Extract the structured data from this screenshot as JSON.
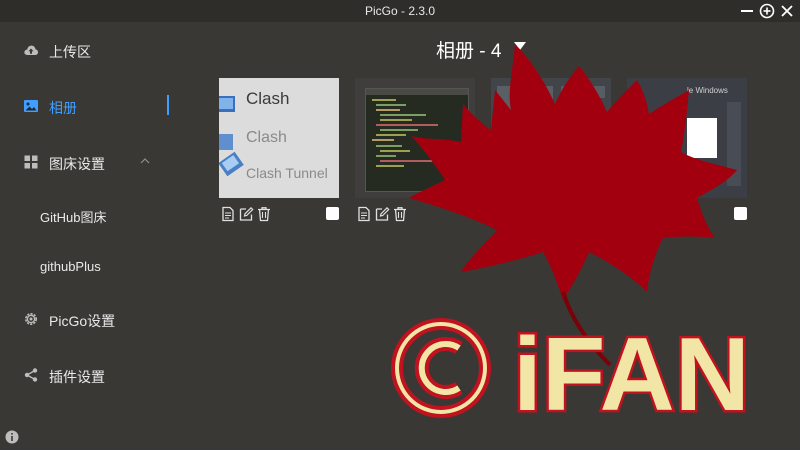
{
  "window": {
    "title": "PicGo - 2.3.0"
  },
  "sidebar": {
    "items": [
      {
        "label": "上传区",
        "icon": "cloud-upload-icon"
      },
      {
        "label": "相册",
        "icon": "image-icon"
      },
      {
        "label": "图床设置",
        "icon": "grid-icon"
      },
      {
        "label": "GitHub图床"
      },
      {
        "label": "githubPlus"
      },
      {
        "label": "PicGo设置",
        "icon": "gear-icon"
      },
      {
        "label": "插件设置",
        "icon": "share-icon"
      }
    ]
  },
  "gallery": {
    "title": "相册 - 4",
    "cards": [
      {
        "lines": [
          "Clash",
          "Clash",
          "Clash Tunnel"
        ]
      },
      {},
      {},
      {
        "caption": "le Windows"
      }
    ]
  },
  "watermark": {
    "text": "© iFAN",
    "logo": "maple-leaf-icon"
  },
  "colors": {
    "accent": "#409eff",
    "background": "#3a3835",
    "titlebar": "#2f2d2a",
    "leaf": "#a3000f",
    "watermark_text": "#f2e6a6"
  }
}
